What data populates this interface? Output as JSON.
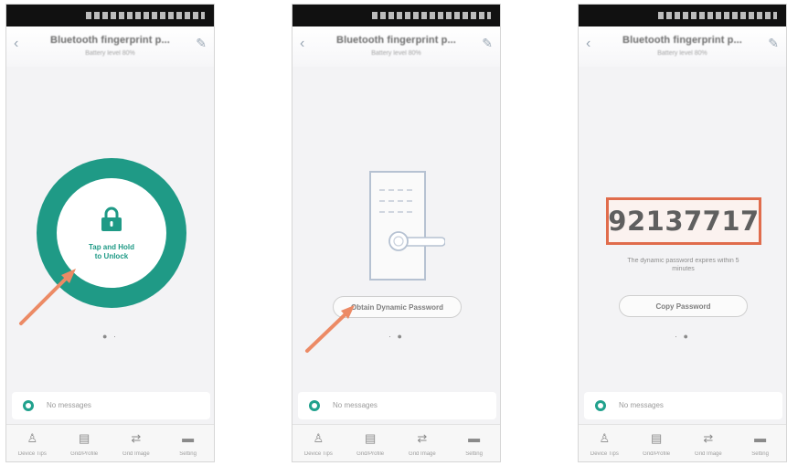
{
  "colors": {
    "accent": "#1f9a86",
    "highlight": "#e06c4c",
    "arrow": "#ec8a65"
  },
  "screens": [
    {
      "title": "Bluetooth fingerprint p...",
      "subtitle": "Battery level 80%",
      "unlock_label_line1": "Tap and Hold",
      "unlock_label_line2": "to Unlock",
      "page_indicator": "● ·",
      "messages": "No messages",
      "nav": [
        "Device Tips",
        "Grid/Profile",
        "Grid Image",
        "Setting"
      ]
    },
    {
      "title": "Bluetooth fingerprint p...",
      "subtitle": "Battery level 80%",
      "button_label": "Obtain Dynamic Password",
      "page_indicator": "· ●",
      "messages": "No messages",
      "nav": [
        "Device Tips",
        "Grid/Profile",
        "Grid Image",
        "Setting"
      ]
    },
    {
      "title": "Bluetooth fingerprint p...",
      "subtitle": "Battery level 80%",
      "password": "92137717",
      "password_note_line1": "The dynamic password expires within 5",
      "password_note_line2": "minutes",
      "button_label": "Copy Password",
      "page_indicator": "· ●",
      "messages": "No messages",
      "nav": [
        "Device Tips",
        "Grid/Profile",
        "Grid Image",
        "Setting"
      ]
    }
  ],
  "icons": {
    "back": "back-arrow-icon",
    "edit": "edit-icon",
    "lock": "lock-icon",
    "message": "message-icon",
    "nav": [
      "person-icon",
      "document-icon",
      "share-icon",
      "more-icon"
    ]
  }
}
